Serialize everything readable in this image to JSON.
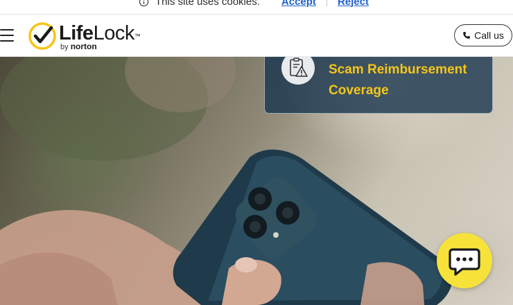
{
  "cookie_bar": {
    "message": "This site uses cookies.",
    "accept_label": "Accept",
    "reject_label": "Reject",
    "icon": "info-icon"
  },
  "header": {
    "menu_icon": "hamburger-menu-icon",
    "logo": {
      "word_regular_1": "Life",
      "word_regular_2": "Lock",
      "trademark": "™",
      "by_text": "by",
      "norton_text": "norton"
    },
    "call_button": {
      "label": "Call us",
      "icon": "phone-icon"
    }
  },
  "hero": {
    "feature_card": {
      "title": "Scam Reimbursement Coverage",
      "icon": "document-warning-icon"
    }
  },
  "chat": {
    "icon": "chat-bubble-icon"
  },
  "colors": {
    "accent_yellow": "#f5c518",
    "link_blue": "#1f5fc9",
    "card_bg": "#14324b",
    "chat_yellow": "#f7e23a"
  }
}
